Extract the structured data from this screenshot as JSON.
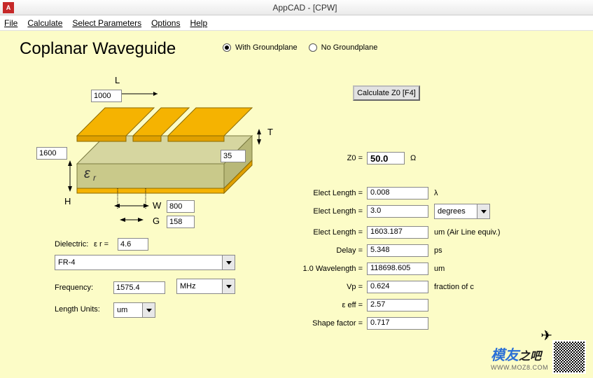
{
  "window": {
    "title": "AppCAD - [CPW]",
    "icon_letter": "A"
  },
  "menu": {
    "file": "File",
    "calculate": "Calculate",
    "select_params": "Select Parameters",
    "options": "Options",
    "help": "Help"
  },
  "heading": "Coplanar Waveguide",
  "gp": {
    "with": "With Groundplane",
    "without": "No Groundplane",
    "selected": "with"
  },
  "calc_button": "Calculate Z0  [F4]",
  "dims": {
    "L_label": "L",
    "L": "1000",
    "T_label": "T",
    "T": "35",
    "H_label": "H",
    "H": "1600",
    "W_label": "W",
    "W": "800",
    "G_label": "G",
    "G": "158",
    "er_symbol": "εᵣ"
  },
  "dielectric": {
    "label": "Dielectric:",
    "er_label": "ε r =",
    "er_value": "4.6",
    "material": "FR-4"
  },
  "frequency": {
    "label": "Frequency:",
    "value": "1575.4",
    "unit": "MHz"
  },
  "length_units": {
    "label": "Length Units:",
    "value": "um"
  },
  "results": {
    "z0": {
      "label": "Z0 =",
      "value": "50.0",
      "unit": "Ω"
    },
    "elen_lambda": {
      "label": "Elect Length =",
      "value": "0.008",
      "unit": "λ"
    },
    "elen_deg": {
      "label": "Elect Length =",
      "value": "3.0",
      "unit": "degrees"
    },
    "elen_um": {
      "label": "Elect Length =",
      "value": "1603.187",
      "unit": "um  (Air Line equiv.)"
    },
    "delay": {
      "label": "Delay =",
      "value": "5.348",
      "unit": "ps"
    },
    "wavelength": {
      "label": "1.0 Wavelength =",
      "value": "118698.605",
      "unit": "um"
    },
    "vp": {
      "label": "Vp =",
      "value": "0.624",
      "unit": "fraction of c"
    },
    "eeff": {
      "label": "ε eff =",
      "value": "2.57",
      "unit": ""
    },
    "shape": {
      "label": "Shape factor =",
      "value": "0.717",
      "unit": ""
    }
  },
  "watermark": {
    "brand": "模友",
    "brand_suffix": "之吧",
    "url": "WWW.MOZ8.COM"
  }
}
